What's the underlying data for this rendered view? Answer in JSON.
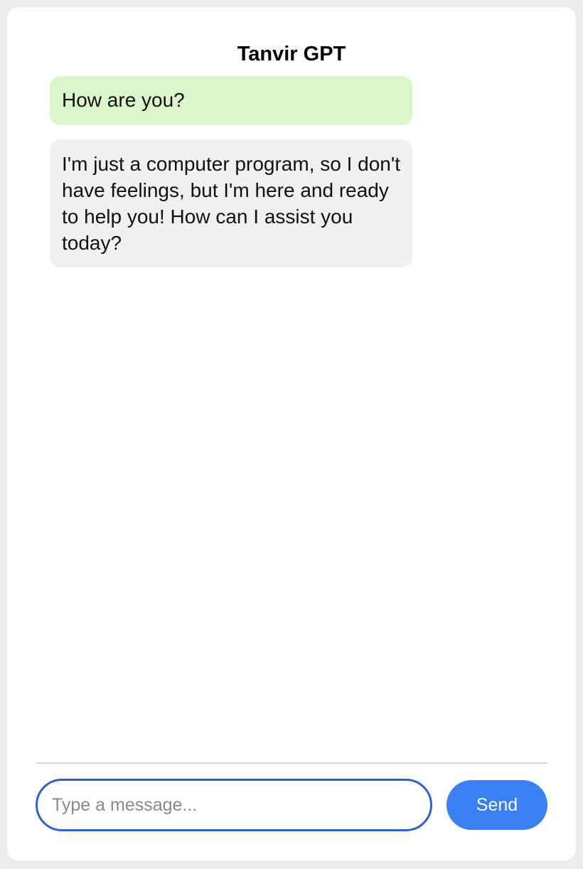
{
  "app": {
    "title": "Tanvir GPT"
  },
  "messages": [
    {
      "role": "user",
      "text": "How are you?"
    },
    {
      "role": "assistant",
      "text": "I'm just a computer program, so I don't have feelings, but I'm here and ready to help you! How can I assist you today?"
    }
  ],
  "composer": {
    "placeholder": "Type a message...",
    "value": "",
    "send_label": "Send"
  },
  "colors": {
    "user_bubble": "#d9f5c9",
    "assistant_bubble": "#f0f0f0",
    "input_border": "#2f62c9",
    "send_button": "#3a80f2"
  }
}
